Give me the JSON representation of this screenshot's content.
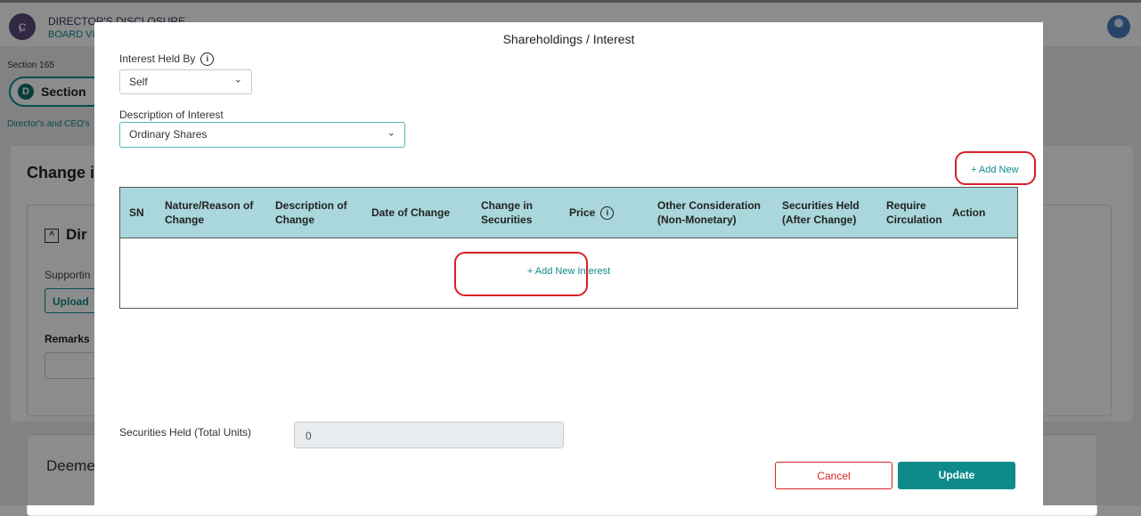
{
  "app": {
    "title": "DIRECTOR'S DISCLOSURE",
    "subtitle": "BOARD VI",
    "section_label": "Section 165",
    "section_pill": "Section",
    "breadcrumb": "Director's and CEO's",
    "card_heading": "Change i",
    "card_sub_heading": "Dir",
    "supporting_label": "Supportin",
    "upload_label": "Upload",
    "remarks_label": "Remarks",
    "deemed_heading": "Deeme"
  },
  "modal": {
    "title": "Shareholdings / Interest",
    "interest_held_by": {
      "label": "Interest Held By",
      "value": "Self"
    },
    "description_of_interest": {
      "label": "Description of Interest",
      "value": "Ordinary Shares"
    },
    "add_new_label": "+ Add New",
    "table": {
      "columns": [
        "SN",
        "Nature/Reason of Change",
        "Description of Change",
        "Date of Change",
        "Change in Securities",
        "Price",
        "Other Consideration (Non-Monetary)",
        "Securities Held (After Change)",
        "Require Circulation",
        "Action"
      ],
      "rows": [],
      "add_interest_label": "+ Add New Interest"
    },
    "securities_total": {
      "label": "Securities Held (Total Units)",
      "value": "0"
    },
    "cancel_label": "Cancel",
    "update_label": "Update"
  },
  "colors": {
    "accent": "#0f8a8c",
    "header_bg": "#a9d7db",
    "danger": "#d81f26"
  },
  "icons": {
    "info": "info-circle-icon",
    "chevron": "chevron-down-icon"
  }
}
